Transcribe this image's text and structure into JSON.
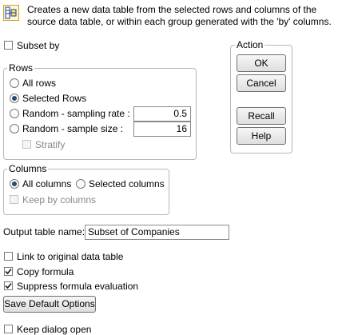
{
  "header": {
    "icon": "subset-table-icon",
    "description_line1": "Creates a new data table from the selected rows and columns of the",
    "description_line2": "source data table, or within each group generated with the 'by' columns."
  },
  "subset_by": {
    "label": "Subset by",
    "checked": false
  },
  "rows": {
    "title": "Rows",
    "all_rows": "All rows",
    "selected_rows": "Selected Rows",
    "random_rate_label": "Random - sampling rate :",
    "random_rate_value": "0.5",
    "random_size_label": "Random - sample size :",
    "random_size_value": "16",
    "stratify": "Stratify",
    "selected": "selected_rows"
  },
  "columns": {
    "title": "Columns",
    "all_columns": "All columns",
    "selected_columns": "Selected columns",
    "keep_by_columns": "Keep by columns",
    "selected": "all_columns"
  },
  "action": {
    "title": "Action",
    "ok": "OK",
    "cancel": "Cancel",
    "recall": "Recall",
    "help": "Help"
  },
  "output": {
    "label": "Output table name:",
    "value": "Subset of Companies"
  },
  "options": {
    "link_original": {
      "label": "Link to original data table",
      "checked": false
    },
    "copy_formula": {
      "label": "Copy formula",
      "checked": true
    },
    "suppress_formula": {
      "label": "Suppress formula evaluation",
      "checked": true
    }
  },
  "save_default": "Save Default Options",
  "keep_open": {
    "label": "Keep dialog open",
    "checked": false
  },
  "colors": {
    "radio_dot": "#2a4a74",
    "border": "#b8b8b8",
    "button_border": "#707070"
  }
}
